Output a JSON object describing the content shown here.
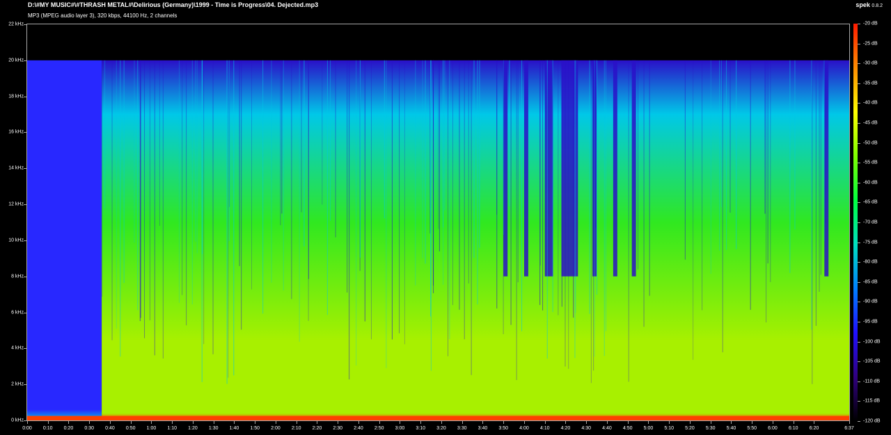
{
  "header": {
    "file_path": "D:\\#MY MUSIC#\\#THRASH METAL#\\Delirious (Germany)\\1999 - Time is Progress\\04. Dejected.mp3",
    "stream_info": "MP3 (MPEG audio layer 3), 320 kbps, 44100 Hz, 2 channels",
    "app_name": "spek",
    "app_version": "0.8.2"
  },
  "chart_data": {
    "type": "heatmap",
    "x_axis": {
      "ticks": [
        "0:00",
        "0:10",
        "0:20",
        "0:30",
        "0:40",
        "0:50",
        "1:00",
        "1:10",
        "1:20",
        "1:30",
        "1:40",
        "1:50",
        "2:00",
        "2:10",
        "2:20",
        "2:30",
        "2:40",
        "2:50",
        "3:00",
        "3:10",
        "3:20",
        "3:30",
        "3:40",
        "3:50",
        "4:00",
        "4:10",
        "4:20",
        "4:30",
        "4:40",
        "4:50",
        "5:00",
        "5:10",
        "5:20",
        "5:30",
        "5:40",
        "5:50",
        "6:00",
        "6:10",
        "6:20",
        "6:37"
      ],
      "tick_seconds": [
        0,
        10,
        20,
        30,
        40,
        50,
        60,
        70,
        80,
        90,
        100,
        110,
        120,
        130,
        140,
        150,
        160,
        170,
        180,
        190,
        200,
        210,
        220,
        230,
        240,
        250,
        260,
        270,
        280,
        290,
        300,
        310,
        320,
        330,
        340,
        350,
        360,
        370,
        380,
        397
      ],
      "range_seconds": [
        0,
        397
      ]
    },
    "y_axis": {
      "ticks": [
        "0 kHz",
        "2 kHz",
        "4 kHz",
        "6 kHz",
        "8 kHz",
        "10 kHz",
        "12 kHz",
        "14 kHz",
        "16 kHz",
        "18 kHz",
        "20 kHz",
        "22 kHz"
      ],
      "tick_khz": [
        0,
        2,
        4,
        6,
        8,
        10,
        12,
        14,
        16,
        18,
        20,
        22
      ],
      "range_khz": [
        0,
        22
      ]
    },
    "color_scale": {
      "labels": [
        "-20 dB",
        "-25 dB",
        "-30 dB",
        "-35 dB",
        "-40 dB",
        "-45 dB",
        "-50 dB",
        "-55 dB",
        "-60 dB",
        "-65 dB",
        "-70 dB",
        "-75 dB",
        "-80 dB",
        "-85 dB",
        "-90 dB",
        "-95 dB",
        "-100 dB",
        "-105 dB",
        "-110 dB",
        "-115 dB",
        "-120 dB"
      ],
      "range_db": [
        -120,
        -20
      ],
      "stops": [
        "#ff1a00",
        "#ff8c00",
        "#ffff00",
        "#7fff00",
        "#00ff40",
        "#00e0c0",
        "#0080ff",
        "#2010ff",
        "#300080",
        "#000000"
      ]
    },
    "spectrum": {
      "cutoff_khz": 20,
      "intro_end_seconds": 36,
      "colors": {
        "intro_low": "#2828ff",
        "body_low": "#a8f000",
        "body_mid": "#30e820",
        "body_high": "#00c8e8",
        "quiet": "#2a10c8",
        "bass": "#ff4000",
        "above_cutoff": "#000000"
      },
      "quiet_regions_seconds": [
        [
          230,
          232
        ],
        [
          240,
          242
        ],
        [
          250,
          254
        ],
        [
          258,
          266
        ],
        [
          273,
          275
        ],
        [
          283,
          285
        ],
        [
          292,
          294
        ],
        [
          385,
          387
        ]
      ]
    }
  }
}
